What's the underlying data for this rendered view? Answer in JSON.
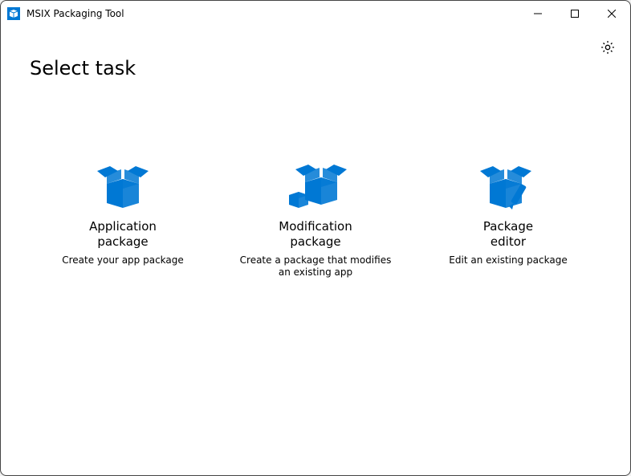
{
  "window": {
    "title": "MSIX Packaging Tool"
  },
  "page": {
    "heading": "Select task"
  },
  "tasks": {
    "application": {
      "title": "Application\npackage",
      "description": "Create your app package"
    },
    "modification": {
      "title": "Modification\npackage",
      "description": "Create a package that modifies an existing app"
    },
    "editor": {
      "title": "Package\neditor",
      "description": "Edit an existing package"
    }
  },
  "colors": {
    "accent": "#0078D4"
  }
}
